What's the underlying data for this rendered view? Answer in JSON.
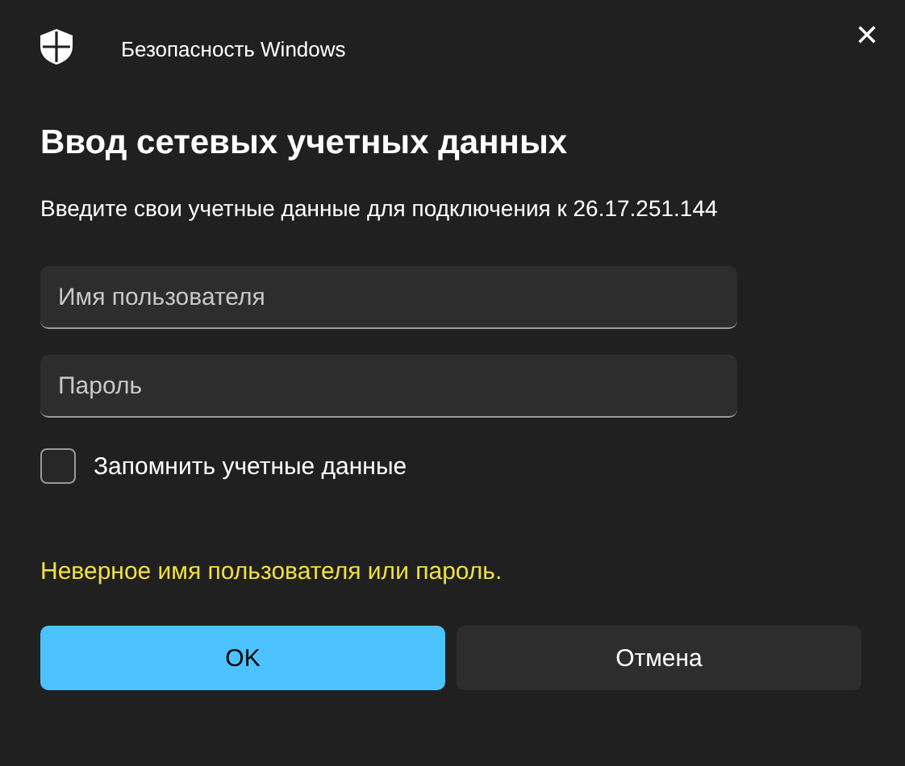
{
  "window": {
    "title": "Безопасность Windows",
    "close": "✕"
  },
  "heading": "Ввод сетевых учетных данных",
  "description": "Введите свои учетные данные для подключения к 26.17.251.144",
  "fields": [
    {
      "placeholder": "Имя пользователя"
    },
    {
      "placeholder": "Пароль"
    }
  ],
  "remember": {
    "label": "Запомнить учетные данные",
    "checked": false
  },
  "error": "Неверное имя пользователя или пароль.",
  "buttons": [
    {
      "label": "OK",
      "kind": "primary"
    },
    {
      "label": "Отмена",
      "kind": "secondary"
    }
  ]
}
